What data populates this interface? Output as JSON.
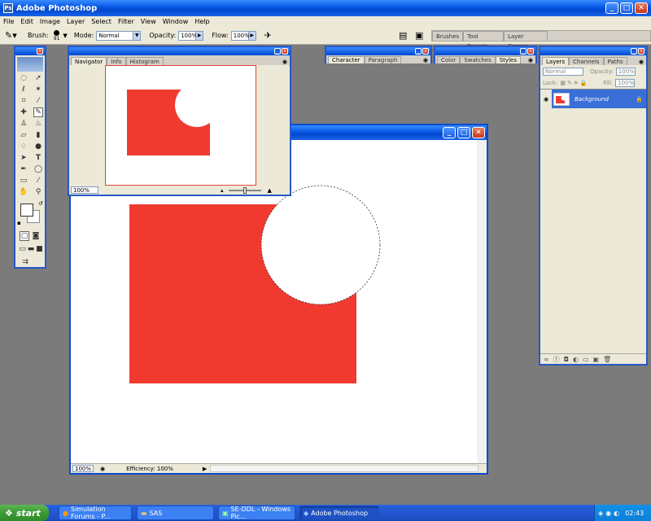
{
  "app": {
    "title": "Adobe Photoshop"
  },
  "menu": [
    "File",
    "Edit",
    "Image",
    "Layer",
    "Select",
    "Filter",
    "View",
    "Window",
    "Help"
  ],
  "options": {
    "brush_label": "Brush:",
    "brush_size": "91",
    "mode_label": "Mode:",
    "mode_value": "Normal",
    "opacity_label": "Opacity:",
    "opacity_value": "100%",
    "flow_label": "Flow:",
    "flow_value": "100%"
  },
  "palette_well": [
    "Brushes",
    "Tool Presets",
    "Layer Comps"
  ],
  "navigator": {
    "tabs": [
      "Navigator",
      "Info",
      "Histogram"
    ],
    "zoom": "100%"
  },
  "character": {
    "tabs": [
      "Character",
      "Paragraph"
    ]
  },
  "color": {
    "tabs": [
      "Color",
      "Swatches",
      "Styles"
    ]
  },
  "layers": {
    "tabs": [
      "Layers",
      "Channels",
      "Paths"
    ],
    "blend_mode": "Normal",
    "opacity_label": "Opacity:",
    "opacity_value": "100%",
    "lock_label": "Lock:",
    "fill_label": "Fill:",
    "fill_value": "100%",
    "layer_name": "Background"
  },
  "document": {
    "zoom": "100%",
    "status": "Efficiency: 100%"
  },
  "taskbar": {
    "start": "start",
    "items": [
      "Simulation Forums - P...",
      "SAS",
      "SE-DDL - Windows Pic...",
      "Adobe Photoshop"
    ],
    "clock": "02:43"
  },
  "colors": {
    "red_shape": "#f03a30",
    "xp_blue": "#0a5ce6"
  }
}
